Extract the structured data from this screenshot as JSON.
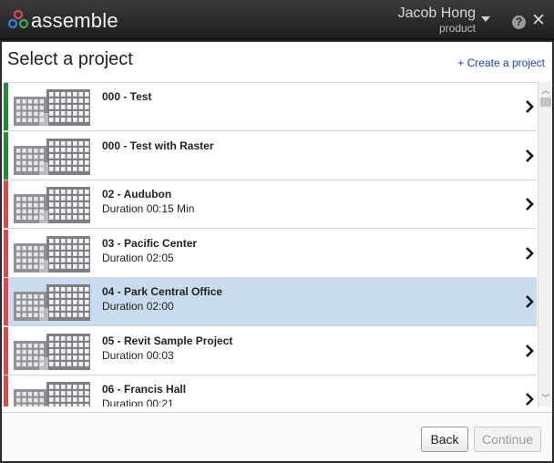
{
  "app": {
    "name": "assemble"
  },
  "user": {
    "name": "Jacob Hong",
    "role": "product"
  },
  "colors": {
    "green": "#1e8e3e",
    "red": "#d9474f",
    "selected": "#c9dcef",
    "link": "#1a3cc8"
  },
  "page": {
    "title": "Select a project",
    "create_link": "+ Create a project"
  },
  "projects": [
    {
      "name": "000 - Test",
      "duration": "",
      "status": "green",
      "selected": false
    },
    {
      "name": "000 - Test with Raster",
      "duration": "",
      "status": "green",
      "selected": false
    },
    {
      "name": "02 - Audubon",
      "duration": "Duration 00:15 Min",
      "status": "red",
      "selected": false
    },
    {
      "name": "03 - Pacific Center",
      "duration": "Duration 02:05",
      "status": "red",
      "selected": false
    },
    {
      "name": "04 - Park Central Office",
      "duration": "Duration 02:00",
      "status": "red",
      "selected": true
    },
    {
      "name": "05 - Revit Sample Project",
      "duration": "Duration 00:03",
      "status": "red",
      "selected": false
    },
    {
      "name": "06 - Francis Hall",
      "duration": "Duration 00:21",
      "status": "red",
      "selected": false
    }
  ],
  "buttons": {
    "back": "Back",
    "continue": "Continue"
  }
}
